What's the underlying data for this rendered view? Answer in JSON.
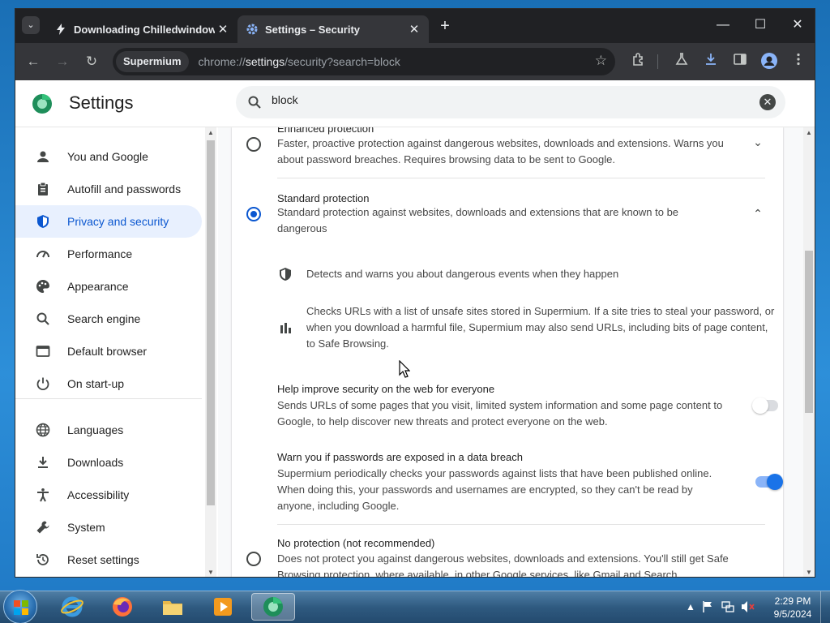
{
  "browser": {
    "tabs": [
      {
        "title": "Downloading Chilledwindows.e",
        "close": "✕"
      },
      {
        "title": "Settings – Security",
        "close": "✕"
      }
    ],
    "new_tab": "+",
    "tab_search": "⌄",
    "window_controls": {
      "minimize": "—",
      "maximize": "☐",
      "close": "✕"
    },
    "nav": {
      "back": "←",
      "forward": "→",
      "reload": "↻"
    },
    "site_chip": "Supermium",
    "url_prefix": "chrome://",
    "url_host": "settings",
    "url_path": "/security?search=block",
    "star": "☆",
    "toolbar_icons": [
      "extensions-icon",
      "labs-icon",
      "download-icon",
      "side-panel-icon",
      "profile-icon",
      "menu-icon"
    ]
  },
  "settings": {
    "title": "Settings",
    "search": {
      "value": "block",
      "clear": "✕"
    },
    "sidebar": {
      "items": [
        {
          "label": "You and Google",
          "icon": "person-icon"
        },
        {
          "label": "Autofill and passwords",
          "icon": "clipboard-icon"
        },
        {
          "label": "Privacy and security",
          "icon": "shield-icon",
          "active": true
        },
        {
          "label": "Performance",
          "icon": "speedometer-icon"
        },
        {
          "label": "Appearance",
          "icon": "palette-icon"
        },
        {
          "label": "Search engine",
          "icon": "search-icon"
        },
        {
          "label": "Default browser",
          "icon": "browser-icon"
        },
        {
          "label": "On start-up",
          "icon": "power-icon"
        },
        {
          "label": "Languages",
          "icon": "globe-icon"
        },
        {
          "label": "Downloads",
          "icon": "download-icon"
        },
        {
          "label": "Accessibility",
          "icon": "accessibility-icon"
        },
        {
          "label": "System",
          "icon": "wrench-icon"
        },
        {
          "label": "Reset settings",
          "icon": "history-icon"
        }
      ]
    },
    "security": {
      "enhanced": {
        "title": "Enhanced protection",
        "desc1": "Faster, proactive protection against dangerous websites, downloads and extensions. Warns you",
        "desc2": "about password breaches. Requires browsing data to be sent to Google.",
        "selected": false,
        "chevron": "⌄"
      },
      "standard": {
        "title": "Standard protection",
        "desc1": "Standard protection against websites, downloads and extensions that are known to be",
        "desc2": "dangerous",
        "selected": true,
        "chevron": "⌃",
        "feature1": "Detects and warns you about dangerous events when they happen",
        "feature2_l1": "Checks URLs with a list of unsafe sites stored in Supermium. If a site tries to steal your password, or",
        "feature2_l2": "when you download a harmful file, Supermium may also send URLs, including bits of page content,",
        "feature2_l3": "to Safe Browsing."
      },
      "help_improve": {
        "title": "Help improve security on the web for everyone",
        "desc1": "Sends URLs of some pages that you visit, limited system information and some page content to",
        "desc2": "Google, to help discover new threats and protect everyone on the web.",
        "enabled": false
      },
      "password_warn": {
        "title": "Warn you if passwords are exposed in a data breach",
        "desc1": "Supermium periodically checks your passwords against lists that have been published online.",
        "desc2": "When doing this, your passwords and usernames are encrypted, so they can't be read by",
        "desc3": "anyone, including Google.",
        "enabled": true
      },
      "no_protection": {
        "title": "No protection (not recommended)",
        "desc1": "Does not protect you against dangerous websites, downloads and extensions. You'll still get Safe",
        "desc2": "Browsing protection, where available, in other Google services, like Gmail and Search.",
        "selected": false
      }
    }
  },
  "taskbar": {
    "apps": [
      "internet-explorer-icon",
      "firefox-icon",
      "file-explorer-icon",
      "media-player-icon",
      "supermium-icon"
    ],
    "time": "2:29 PM",
    "date": "9/5/2024",
    "tray_arrow": "▲"
  },
  "colors": {
    "accent": "#0b57d0",
    "active_bg": "#e8f0fe",
    "toggle_on": "#1a73e8",
    "tab_bg": "#202124"
  }
}
